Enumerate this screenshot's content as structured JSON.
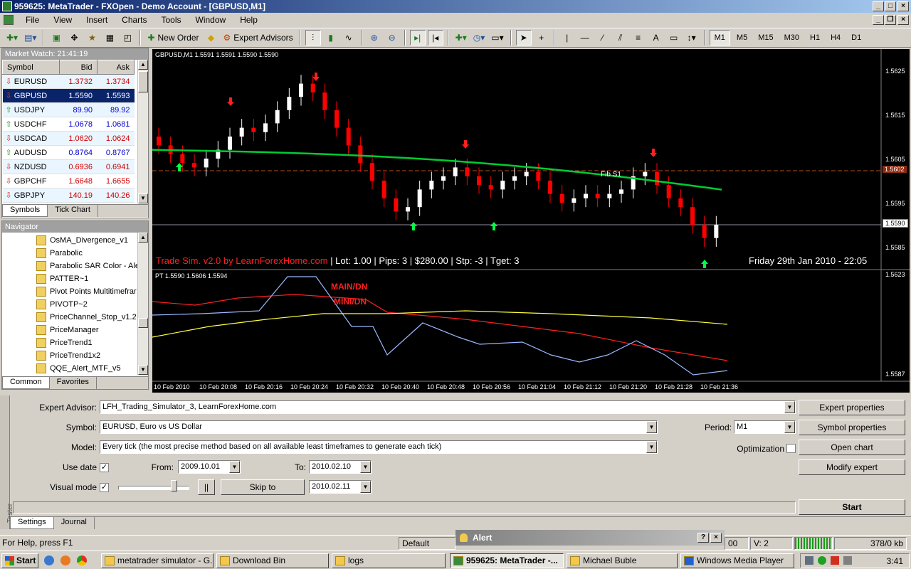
{
  "window": {
    "title": "959625: MetaTrader - FXOpen - Demo Account - [GBPUSD,M1]"
  },
  "menu": [
    "File",
    "View",
    "Insert",
    "Charts",
    "Tools",
    "Window",
    "Help"
  ],
  "toolbar": {
    "new_order": "New Order",
    "expert_advisors": "Expert Advisors",
    "timeframes": [
      "M1",
      "M5",
      "M15",
      "M30",
      "H1",
      "H4",
      "D1"
    ],
    "active_timeframe": "M1",
    "text_tool": "A"
  },
  "market_watch": {
    "title": "Market Watch: 21:41:19",
    "headers": [
      "Symbol",
      "Bid",
      "Ask"
    ],
    "rows": [
      {
        "symbol": "EURUSD",
        "bid": "1.3732",
        "ask": "1.3734",
        "dir": "dn"
      },
      {
        "symbol": "GBPUSD",
        "bid": "1.5590",
        "ask": "1.5593",
        "dir": "dn"
      },
      {
        "symbol": "USDJPY",
        "bid": "89.90",
        "ask": "89.92",
        "dir": "up"
      },
      {
        "symbol": "USDCHF",
        "bid": "1.0678",
        "ask": "1.0681",
        "dir": "up"
      },
      {
        "symbol": "USDCAD",
        "bid": "1.0620",
        "ask": "1.0624",
        "dir": "dn"
      },
      {
        "symbol": "AUDUSD",
        "bid": "0.8764",
        "ask": "0.8767",
        "dir": "up"
      },
      {
        "symbol": "NZDUSD",
        "bid": "0.6936",
        "ask": "0.6941",
        "dir": "dn"
      },
      {
        "symbol": "GBPCHF",
        "bid": "1.6648",
        "ask": "1.6655",
        "dir": "dn"
      },
      {
        "symbol": "GBPJPY",
        "bid": "140.19",
        "ask": "140.26",
        "dir": "dn"
      }
    ],
    "tabs": [
      "Symbols",
      "Tick Chart"
    ]
  },
  "navigator": {
    "title": "Navigator",
    "items": [
      "OsMA_Divergence_v1",
      "Parabolic",
      "Parabolic SAR Color - Ale",
      "PATTER~1",
      "Pivot Points Multitimefrar",
      "PIVOTP~2",
      "PriceChannel_Stop_v1.2",
      "PriceManager",
      "PriceTrend1",
      "PriceTrend1x2",
      "QQE_Alert_MTF_v5"
    ],
    "tabs": [
      "Common",
      "Favorites"
    ]
  },
  "chart": {
    "header": "GBPUSD,M1  1.5591 1.5591 1.5590 1.5590",
    "price_labels": [
      "1.5625",
      "1.5615",
      "1.5605",
      "1.5595",
      "1.5585"
    ],
    "current_price": "1.5590",
    "line_price": "1.5602",
    "fib_label": "Fib S1",
    "trade_sim": "Trade Sim. v2.0 by LearnForexHome.com",
    "trade_info": "| Lot: 1.00 | Pips: 3 | $280.00 | Stp: -3 | Tget: 3",
    "datetime": "Friday 29th Jan 2010 - 22:05",
    "indicator_header": "PT 1.5590 1.5606 1.5594",
    "indicator_labels": [
      "MAIN/DN",
      "MINI/DN"
    ],
    "indicator_price_labels": [
      "1.5623",
      "1.5587"
    ],
    "time_labels": [
      "10 Feb 2010",
      "10 Feb 20:08",
      "10 Feb 20:16",
      "10 Feb 20:24",
      "10 Feb 20:32",
      "10 Feb 20:40",
      "10 Feb 20:48",
      "10 Feb 20:56",
      "10 Feb 21:04",
      "10 Feb 21:12",
      "10 Feb 21:20",
      "10 Feb 21:28",
      "10 Feb 21:36"
    ],
    "colors": {
      "bull": "#ffffff",
      "bear": "#ff0000",
      "ma": "#00cc33",
      "up_arrow": "#00ff44",
      "down_arrow": "#ff2020"
    }
  },
  "tester": {
    "side_label": "Tester",
    "expert_label": "Expert Advisor:",
    "expert_value": "LFH_Trading_Simulator_3, LearnForexHome.com",
    "symbol_label": "Symbol:",
    "symbol_value": "EURUSD, Euro vs US Dollar",
    "model_label": "Model:",
    "model_value": "Every tick (the most precise method based on all available least timeframes to generate each tick)",
    "use_date_label": "Use date",
    "from_label": "From:",
    "from_value": "2009.10.01",
    "to_label": "To:",
    "to_value": "2010.02.10",
    "visual_label": "Visual mode",
    "skip_label": "Skip to",
    "skip_value": "2010.02.11",
    "period_label": "Period:",
    "period_value": "M1",
    "optimization_label": "Optimization",
    "pause_glyph": "||",
    "check_glyph": "✓",
    "buttons": {
      "expert_properties": "Expert properties",
      "symbol_properties": "Symbol properties",
      "open_chart": "Open chart",
      "modify_expert": "Modify expert",
      "start": "Start"
    },
    "tabs": [
      "Settings",
      "Journal"
    ]
  },
  "alert": {
    "title": "Alert"
  },
  "status": {
    "help": "For Help, press F1",
    "profile": "Default",
    "partial": "00",
    "v": "V: 2",
    "traffic": "378/0 kb"
  },
  "taskbar": {
    "start": "Start",
    "tasks": [
      "metatrader simulator - G...",
      "Download Bin",
      "logs",
      "959625: MetaTrader -...",
      "Michael Buble",
      "Windows Media Player"
    ],
    "clock": "3:41"
  }
}
